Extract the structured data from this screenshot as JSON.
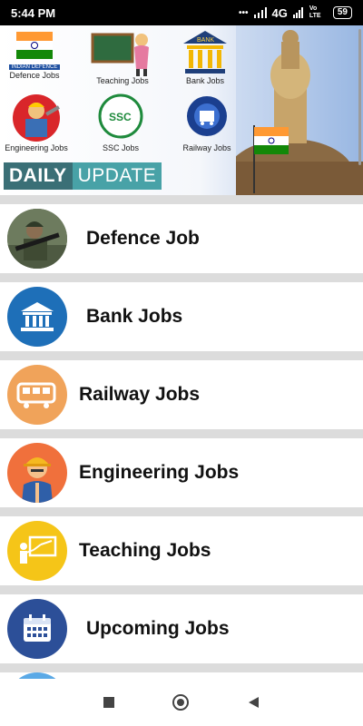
{
  "status_bar": {
    "time": "5:44 PM",
    "network": "4G",
    "volte": "Vo LTE",
    "battery": "59"
  },
  "banner": {
    "categories": [
      {
        "name": "Defence Jobs",
        "badge": "INDIAN DEFENCE"
      },
      {
        "name": "Teaching Jobs"
      },
      {
        "name": "Bank Jobs",
        "badge": "BANK"
      },
      {
        "name": "Engineering Jobs"
      },
      {
        "name": "SSC Jobs",
        "badge": "SSC"
      },
      {
        "name": "Railway Jobs"
      }
    ],
    "daily_left": "DAILY",
    "daily_right": "UPDATE"
  },
  "list": {
    "items": [
      {
        "label": "Defence Job"
      },
      {
        "label": "Bank Jobs"
      },
      {
        "label": "Railway Jobs"
      },
      {
        "label": "Engineering Jobs"
      },
      {
        "label": "Teaching Jobs"
      },
      {
        "label": "Upcoming Jobs"
      }
    ]
  },
  "colors": {
    "bank": "#1e6fb8",
    "railway": "#f0a35a",
    "engineering": "#f0703c",
    "teaching": "#f5c518",
    "upcoming": "#2c4f98",
    "separator": "#dcdcdc"
  },
  "icons": [
    "soldier-photo",
    "bank-building-icon",
    "train-icon",
    "engineer-avatar-icon",
    "teacher-board-icon",
    "calendar-icon"
  ]
}
